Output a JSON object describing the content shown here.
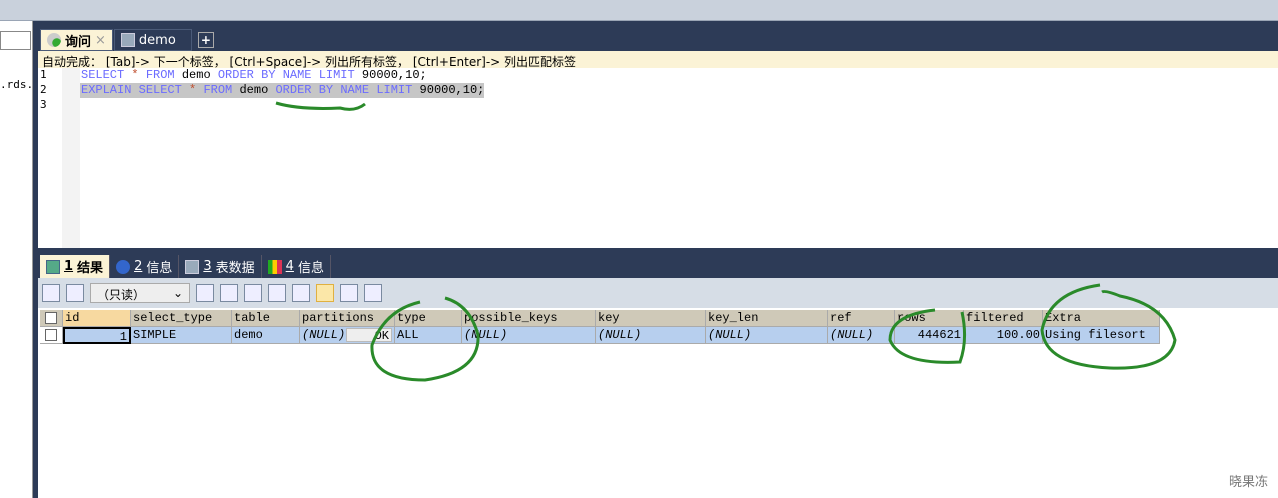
{
  "left": {
    "text": ".rds."
  },
  "tabs": [
    {
      "label": "询问",
      "close": "×"
    },
    {
      "label": "demo"
    }
  ],
  "new_tab": "+",
  "editor": {
    "hint": "自动完成： [Tab]-> 下一个标签， [Ctrl+Space]-> 列出所有标签， [Ctrl+Enter]-> 列出匹配标签",
    "line_numbers": [
      "1",
      "2",
      "3"
    ],
    "lines": [
      "SELECT * FROM demo ORDER BY NAME LIMIT 90000,10;",
      "EXPLAIN SELECT * FROM demo ORDER BY NAME LIMIT 90000,10;"
    ]
  },
  "result_tabs": [
    {
      "num": "1",
      "label": "结果"
    },
    {
      "num": "2",
      "label": "信息"
    },
    {
      "num": "3",
      "label": "表数据"
    },
    {
      "num": "4",
      "label": "信息"
    }
  ],
  "toolbar": {
    "mode": "（只读）",
    "arrow": "⌄"
  },
  "grid": {
    "columns": [
      "id",
      "select_type",
      "table",
      "partitions",
      "type",
      "possible_keys",
      "key",
      "key_len",
      "ref",
      "rows",
      "filtered",
      "Extra"
    ],
    "rows": [
      [
        "1",
        "SIMPLE",
        "demo",
        "(NULL)",
        "ALL",
        "(NULL)",
        "(NULL)",
        "(NULL)",
        "(NULL)",
        "444621",
        "100.00",
        "Using filesort"
      ]
    ],
    "ok_button": "OK"
  },
  "watermark": "晓果冻",
  "colors": {
    "frame": "#2d3b57",
    "active_tab": "#fbf3d6",
    "row": "#b7cfee",
    "header": "#cfc9b8",
    "annotation": "#2a8a2a"
  }
}
